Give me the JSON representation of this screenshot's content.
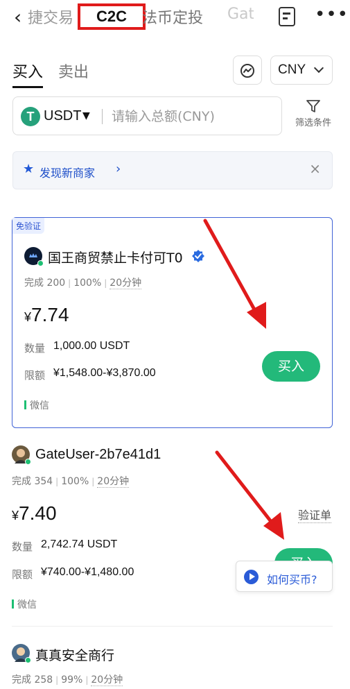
{
  "header": {
    "back_symbol": "‹",
    "tabs": {
      "prev": "捷交易",
      "active": "C2C",
      "next": "法币定投",
      "faded": "Gat"
    },
    "more_symbol": "•••"
  },
  "subtabs": {
    "buy": "买入",
    "sell": "卖出"
  },
  "currency": "CNY",
  "search": {
    "coin": "USDT",
    "caret": "▼",
    "placeholder": "请输入总额(CNY)",
    "filter_label": "筛选条件"
  },
  "banner": {
    "text": "发现新商家",
    "chevron": "›",
    "close": "×"
  },
  "ads": [
    {
      "badge": "免验证",
      "name": "国王商贸禁止卡付可T0",
      "verified": true,
      "stats": {
        "completed": "完成 200",
        "rate": "100%",
        "time": "20分钟"
      },
      "price_symbol": "¥",
      "price": "7.74",
      "quantity_label": "数量",
      "quantity": "1,000.00 USDT",
      "limit_label": "限额",
      "limit": "¥1,548.00-¥3,870.00",
      "payment": "微信",
      "buy_label": "买入"
    },
    {
      "name": "GateUser-2b7e41d1",
      "stats": {
        "completed": "完成 354",
        "rate": "100%",
        "time": "20分钟"
      },
      "price_symbol": "¥",
      "price": "7.40",
      "verify_link": "验证单",
      "quantity_label": "数量",
      "quantity": "2,742.74 USDT",
      "limit_label": "限额",
      "limit": "¥740.00-¥1,480.00",
      "payment": "微信",
      "buy_label": "买入"
    },
    {
      "name": "真真安全商行",
      "stats": {
        "completed": "完成 258",
        "rate": "99%",
        "time": "20分钟"
      }
    }
  ],
  "howto": {
    "label": "如何买币?"
  },
  "colors": {
    "accent_green": "#23b97a",
    "accent_blue": "#2a5bd7",
    "annotation_red": "#e01b1b"
  }
}
